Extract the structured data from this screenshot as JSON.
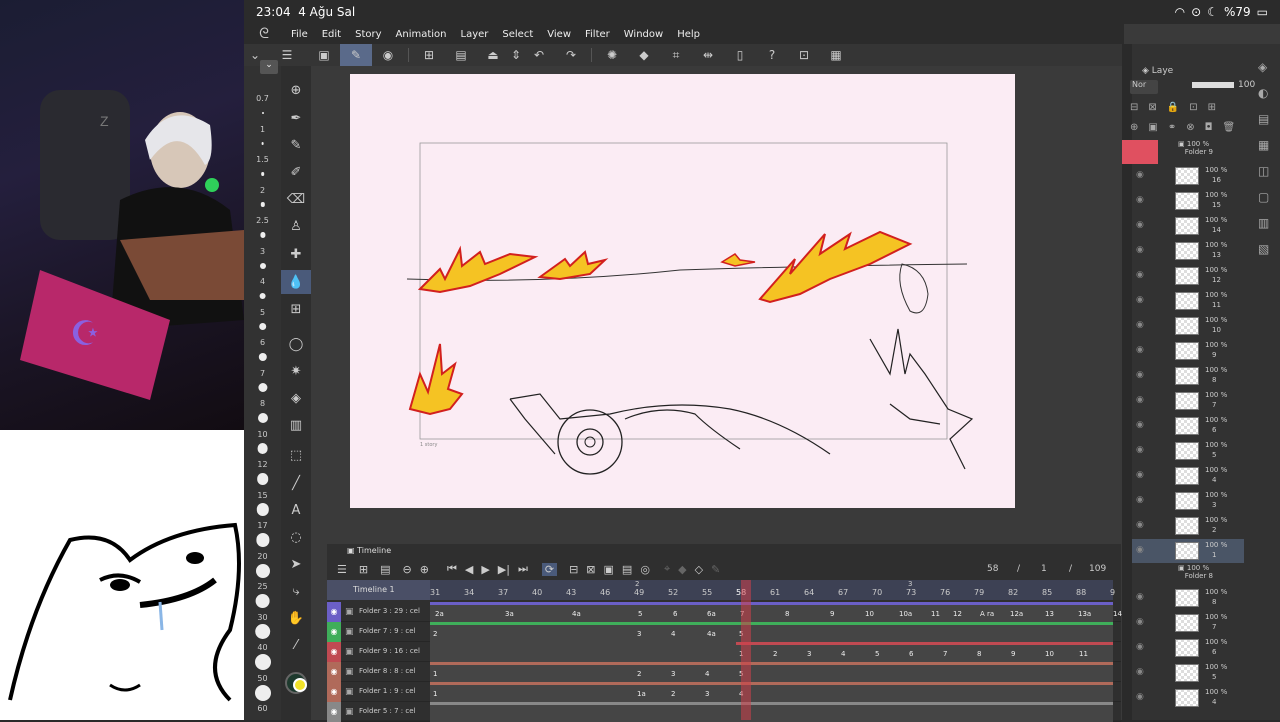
{
  "status": {
    "time": "23:04",
    "date": "4 Ağu Sal",
    "battery": "%79"
  },
  "menu": {
    "items": [
      "File",
      "Edit",
      "Story",
      "Animation",
      "Layer",
      "Select",
      "View",
      "Filter",
      "Window",
      "Help"
    ]
  },
  "brush_sizes": [
    "0.7",
    "1",
    "1.5",
    "2",
    "2.5",
    "3",
    "4",
    "5",
    "6",
    "7",
    "8",
    "10",
    "12",
    "15",
    "17",
    "20",
    "25",
    "30",
    "40",
    "50",
    "60"
  ],
  "canvas": {
    "frame_label": "1 story"
  },
  "layers_panel": {
    "tab": "Laye",
    "blend": "Nor",
    "opacity": "100",
    "folder_top": {
      "opacity": "100 %",
      "name": "Folder 9"
    },
    "folder_bottom": {
      "opacity": "100 %",
      "name": "Folder 8"
    },
    "upper_layers": [
      {
        "opacity": "100 %",
        "name": "16"
      },
      {
        "opacity": "100 %",
        "name": "15"
      },
      {
        "opacity": "100 %",
        "name": "14"
      },
      {
        "opacity": "100 %",
        "name": "13"
      },
      {
        "opacity": "100 %",
        "name": "12"
      },
      {
        "opacity": "100 %",
        "name": "11"
      },
      {
        "opacity": "100 %",
        "name": "10"
      },
      {
        "opacity": "100 %",
        "name": "9"
      },
      {
        "opacity": "100 %",
        "name": "8"
      },
      {
        "opacity": "100 %",
        "name": "7"
      },
      {
        "opacity": "100 %",
        "name": "6"
      },
      {
        "opacity": "100 %",
        "name": "5"
      },
      {
        "opacity": "100 %",
        "name": "4"
      },
      {
        "opacity": "100 %",
        "name": "3"
      },
      {
        "opacity": "100 %",
        "name": "2"
      },
      {
        "opacity": "100 %",
        "name": "1"
      }
    ],
    "lower_layers": [
      {
        "opacity": "100 %",
        "name": "8"
      },
      {
        "opacity": "100 %",
        "name": "7"
      },
      {
        "opacity": "100 %",
        "name": "6"
      },
      {
        "opacity": "100 %",
        "name": "5"
      },
      {
        "opacity": "100 %",
        "name": "4"
      }
    ]
  },
  "timeline": {
    "title": "Timeline",
    "track_name": "Timeline 1",
    "current_frame": "58",
    "sep1": "/",
    "page": "1",
    "sep2": "/",
    "total_frames": "109",
    "ruler_marks": [
      "31",
      "34",
      "37",
      "40",
      "43",
      "46",
      "49",
      "52",
      "55",
      "58",
      "61",
      "64",
      "67",
      "70",
      "73",
      "76",
      "79",
      "82",
      "85",
      "88",
      "9"
    ],
    "ruler_sub": [
      "2",
      "3"
    ],
    "tracks": [
      {
        "name": "Folder 3 : 29 : cel",
        "color": "#6b5fc6",
        "cels": [
          "2a",
          "3a",
          "4a",
          "5",
          "6",
          "6a",
          "7",
          "8",
          "9",
          "10",
          "10a",
          "11",
          "12",
          "A ra",
          "12a",
          "13",
          "13a",
          "14"
        ]
      },
      {
        "name": "Folder 7 : 9 : cel",
        "color": "#3fae5a",
        "cels": [
          "2",
          "3",
          "4",
          "4a",
          "5"
        ]
      },
      {
        "name": "Folder 9 : 16 : cel",
        "color": "#c04a52",
        "cels": [
          "1",
          "2",
          "3",
          "4",
          "5",
          "6",
          "7",
          "8",
          "9",
          "10",
          "11"
        ]
      },
      {
        "name": "Folder 8 : 8 : cel",
        "color": "#b06a5a",
        "cels": [
          "1",
          "2",
          "3",
          "4",
          "5"
        ]
      },
      {
        "name": "Folder 1 : 9 : cel",
        "color": "#b06a5a",
        "cels": [
          "1",
          "1a",
          "2",
          "3",
          "4"
        ]
      },
      {
        "name": "Folder 5 : 7 : cel",
        "color": "#888888",
        "cels": []
      }
    ]
  },
  "colors": {
    "accent": "#5a6a8a",
    "playhead": "#d0404a",
    "paper": "#fbecf4"
  }
}
